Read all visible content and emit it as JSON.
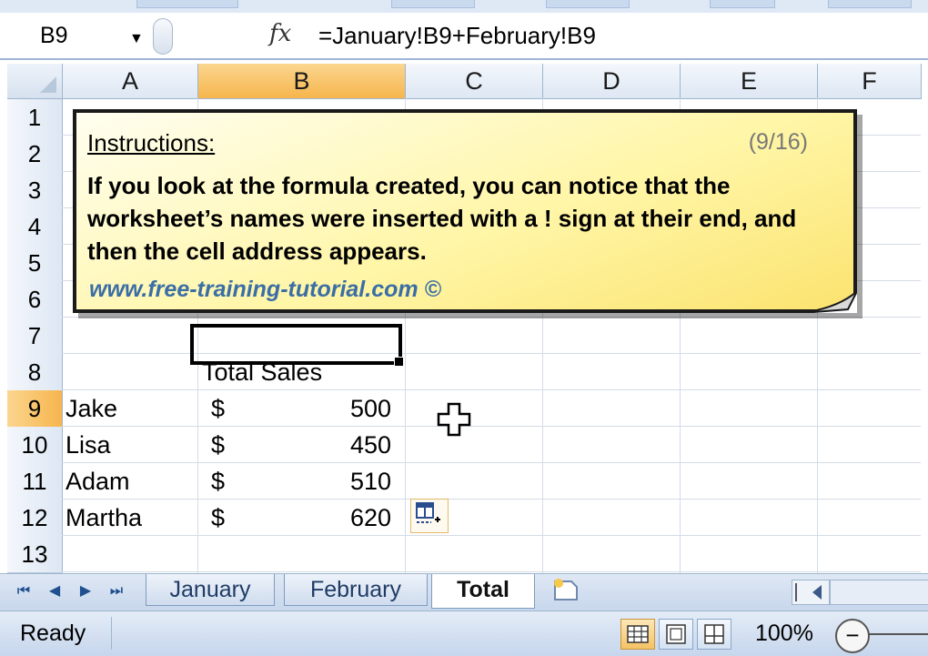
{
  "formula_bar": {
    "name_box": "B9",
    "fx_label": "fx",
    "formula": "=January!B9+February!B9"
  },
  "columns": [
    "A",
    "B",
    "C",
    "D",
    "E",
    "F"
  ],
  "selected_column": "B",
  "rows": [
    "1",
    "2",
    "3",
    "4",
    "5",
    "6",
    "7",
    "8",
    "9",
    "10",
    "11",
    "12",
    "13"
  ],
  "selected_row": "9",
  "sheet": {
    "header_label": "Total Sales",
    "currency_symbol": "$",
    "entries": [
      {
        "name": "Jake",
        "amount": "500"
      },
      {
        "name": "Lisa",
        "amount": "450"
      },
      {
        "name": "Adam",
        "amount": "510"
      },
      {
        "name": "Martha",
        "amount": "620"
      }
    ]
  },
  "callout": {
    "title": "Instructions:",
    "counter": "(9/16)",
    "body": "If you look at the formula created, you can notice that the worksheet’s names were inserted with a ! sign at their end, and then the cell address appears.",
    "link": "www.free-training-tutorial.com ©"
  },
  "tabs": {
    "nav_first": "⏮",
    "nav_prev": "◀",
    "nav_next": "▶",
    "nav_last": "⏭",
    "items": [
      "January",
      "February",
      "Total"
    ],
    "active": "Total"
  },
  "status_bar": {
    "status": "Ready",
    "zoom": "100%",
    "zoom_out": "−"
  },
  "colors": {
    "selected_header": "#f6b54d",
    "callout_fill": "#fff6a8",
    "link": "#3a6ea5"
  }
}
